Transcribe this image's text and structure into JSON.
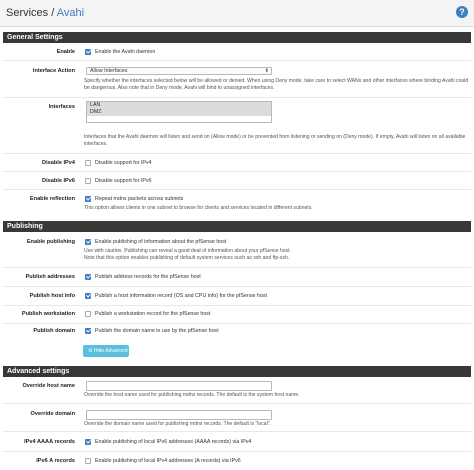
{
  "breadcrumb": {
    "section": "Services",
    "separator": "/",
    "page": "Avahi"
  },
  "header": {
    "help_icon": "question-circle-icon"
  },
  "general": {
    "title": "General Settings",
    "enable": {
      "label": "Enable",
      "text": "Enable the Avahi daemon",
      "checked": true
    },
    "interface_action": {
      "label": "Interface Action",
      "selected": "Allow Interfaces",
      "help": "Specify whether the interfaces selected below will be allowed or denied. When using Deny mode, take care to select WANs and other interfaces where binding Avahi could be dangerous. Also note that in Deny mode, Avahi will bind to unassigned interfaces."
    },
    "interfaces": {
      "label": "Interfaces",
      "options": [
        "LAN",
        "DMZ"
      ],
      "help": "Interfaces that the Avahi daemon will listen and send on (Allow mode) or be prevented from listening or sending on (Deny mode). If empty, Avahi will listen on all available interfaces."
    },
    "disable_ipv4": {
      "label": "Disable IPv4",
      "text": "Disable support for IPv4",
      "checked": false
    },
    "disable_ipv6": {
      "label": "Disable IPv6",
      "text": "Disable support for IPv6",
      "checked": false
    },
    "enable_reflection": {
      "label": "Enable reflection",
      "text": "Repeat mdns packets across subnets",
      "checked": true,
      "help": "This option allows clients in one subnet to browse for clients and services located in different subnets."
    }
  },
  "publishing": {
    "title": "Publishing",
    "enable_publishing": {
      "label": "Enable publishing",
      "text": "Enable publishing of information about the pfSense host",
      "checked": true,
      "help1": "Use with caution. Publishing can reveal a good deal of information about your pfSense host.",
      "help2": "Note that this option enables publishing of default system services such as ssh and ftp-ssh."
    },
    "publish_addresses": {
      "label": "Publish addresses",
      "text": "Publish address records for the pfSense host",
      "checked": true
    },
    "publish_host_info": {
      "label": "Publish host info",
      "text": "Publish a host information record (OS and CPU info) for the pfSense host",
      "checked": true
    },
    "publish_workstation": {
      "label": "Publish workstation",
      "text": "Publish a workstation record for the pfSense host",
      "checked": false
    },
    "publish_domain": {
      "label": "Publish domain",
      "text": "Publish the domain name in use by the pfSense host",
      "checked": true
    },
    "hide_advanced": "Hide Advanced"
  },
  "advanced": {
    "title": "Advanced settings",
    "override_host": {
      "label": "Override host name",
      "value": "",
      "help": "Override the host name used for publishing mdns records. The default is the system host name."
    },
    "override_domain": {
      "label": "Override domain",
      "value": "",
      "help": "Override the domain name used for publishing mdns records. The default is \"local\"."
    },
    "ipv4_aaaa": {
      "label": "IPv4 AAAA records",
      "text": "Enable publishing of local IPv6 addresses (AAAA records) via IPv4",
      "checked": true
    },
    "ipv6_a": {
      "label": "IPv6 A records",
      "text": "Enable publishing of local IPv4 addresses (A records) via IPv6",
      "checked": false
    }
  }
}
